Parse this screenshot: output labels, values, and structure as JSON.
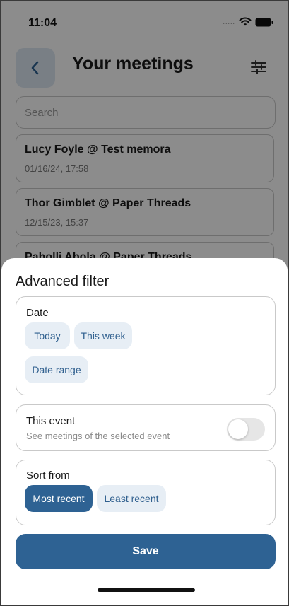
{
  "status_bar": {
    "time": "11:04",
    "signal_text": "....."
  },
  "header": {
    "title": "Your meetings"
  },
  "search": {
    "placeholder": "Search"
  },
  "meetings": [
    {
      "title": "Lucy Foyle @ Test memora",
      "date": "01/16/24, 17:58"
    },
    {
      "title": "Thor Gimblet @ Paper Threads",
      "date": "12/15/23, 15:37"
    },
    {
      "title": "Paholli Abola @ Paper Threads",
      "date": ""
    }
  ],
  "filter_sheet": {
    "title": "Advanced filter",
    "date_section": {
      "label": "Date",
      "options": [
        "Today",
        "This week",
        "Date range"
      ]
    },
    "event_section": {
      "label": "This event",
      "description": "See meetings of the selected event",
      "toggle_on": false
    },
    "sort_section": {
      "label": "Sort from",
      "options": [
        "Most recent",
        "Least recent"
      ],
      "selected": "Most recent"
    },
    "save_label": "Save"
  },
  "colors": {
    "primary": "#2e6293",
    "chip_bg": "#e7eef5",
    "chip_text": "#2f5f8e"
  }
}
